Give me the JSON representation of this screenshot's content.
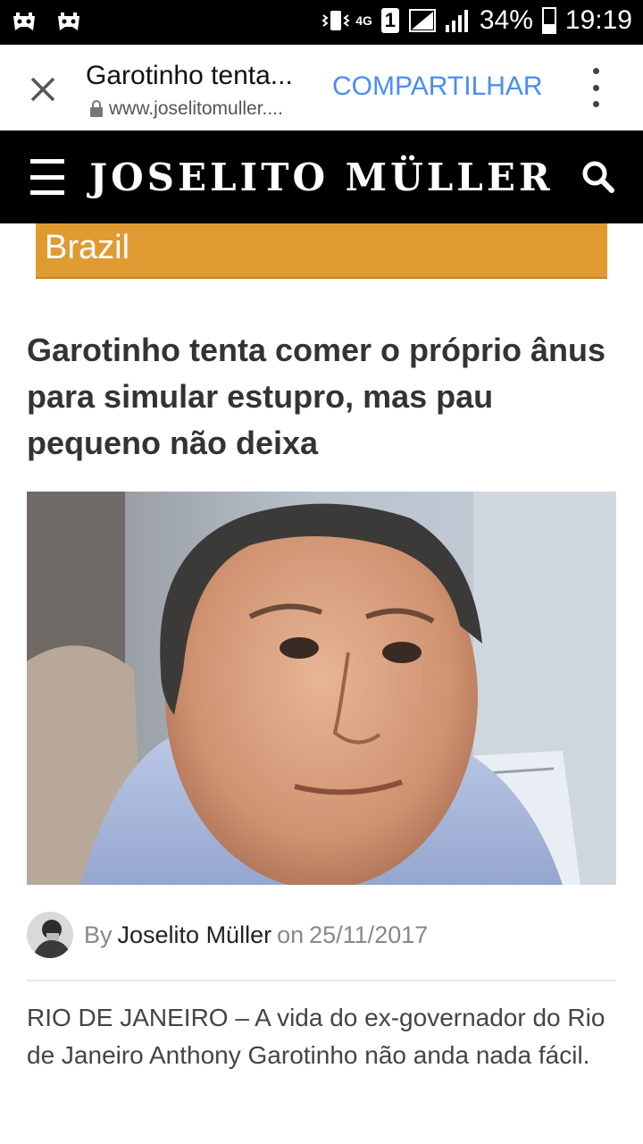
{
  "status_bar": {
    "network": "4G",
    "sim_slot": "1",
    "battery": "34%",
    "time": "19:19",
    "icons": [
      "game-controller-icon",
      "game-controller-icon",
      "vibrate-icon",
      "signal-icon",
      "battery-icon"
    ]
  },
  "toolbar": {
    "title": "Garotinho tenta...",
    "url": "www.joselitomuller....",
    "share_label": "COMPARTILHAR"
  },
  "site": {
    "brand": "JOSELITO MÜLLER"
  },
  "article": {
    "category": "Brazil",
    "headline": "Garotinho tenta comer o próprio ânus para simular estupro, mas pau pequeno não deixa",
    "by_label": "By",
    "author": "Joselito Müller",
    "on_label": "on",
    "date": "25/11/2017",
    "body": "RIO DE JANEIRO – A vida do ex-governador do Rio de Janeiro Anthony Garotinho não anda nada fácil."
  },
  "colors": {
    "category_bg": "#df9b32",
    "share_link": "#4a8ef0",
    "site_bar": "#000000"
  }
}
